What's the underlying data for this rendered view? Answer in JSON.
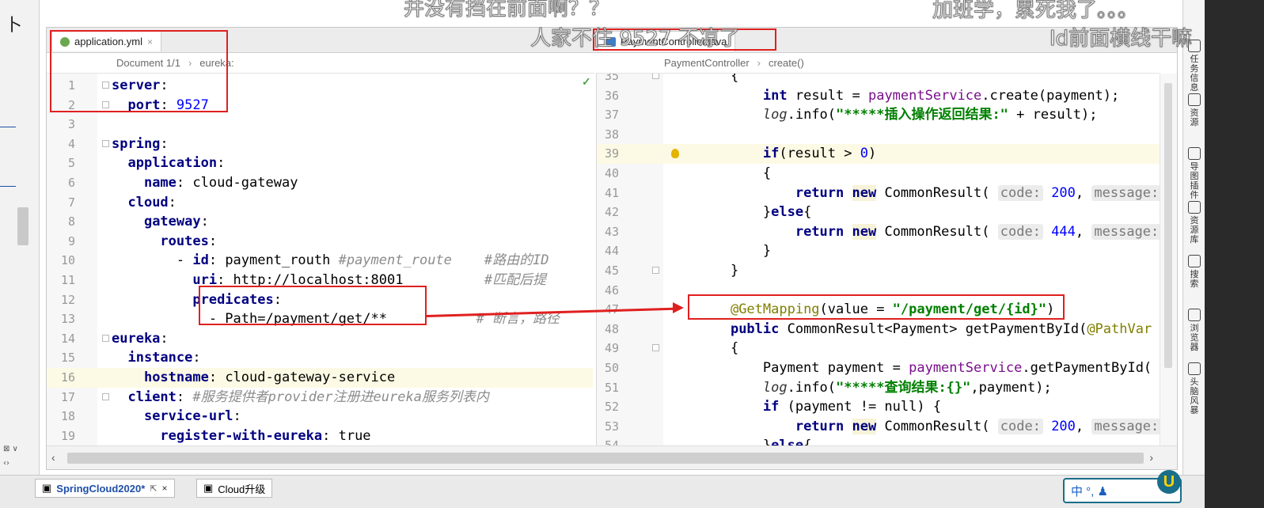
{
  "tabs": [
    {
      "label": "application.yml",
      "type": "yml"
    },
    {
      "label": "PaymentController.java",
      "type": "java"
    }
  ],
  "left_crumbs": [
    "Document 1/1",
    "eureka:"
  ],
  "right_crumbs": [
    "PaymentController",
    "create()"
  ],
  "yml_lines": [
    {
      "n": "1",
      "code": "server:"
    },
    {
      "n": "2",
      "code": "  port: 9527"
    },
    {
      "n": "3",
      "code": ""
    },
    {
      "n": "4",
      "code": "spring:"
    },
    {
      "n": "5",
      "code": "  application:"
    },
    {
      "n": "6",
      "code": "    name: cloud-gateway"
    },
    {
      "n": "7",
      "code": "  cloud:"
    },
    {
      "n": "8",
      "code": "    gateway:"
    },
    {
      "n": "9",
      "code": "      routes:"
    },
    {
      "n": "10",
      "code": "        - id: payment_routh #payment_route    #路由的ID"
    },
    {
      "n": "11",
      "code": "          uri: http://localhost:8001          #匹配后提"
    },
    {
      "n": "12",
      "code": "          predicates:"
    },
    {
      "n": "13",
      "code": "            - Path=/payment/get/**           # 断言，路径"
    },
    {
      "n": "14",
      "code": "eureka:"
    },
    {
      "n": "15",
      "code": "  instance:"
    },
    {
      "n": "16",
      "code": "    hostname: cloud-gateway-service"
    },
    {
      "n": "17",
      "code": "  client: #服务提供者provider注册进eureka服务列表内"
    },
    {
      "n": "18",
      "code": "    service-url:"
    },
    {
      "n": "19",
      "code": "      register-with-eureka: true"
    }
  ],
  "java_lines": [
    {
      "n": "35",
      "code": "    {"
    },
    {
      "n": "36",
      "code": "        int result = paymentService.create(payment);"
    },
    {
      "n": "37",
      "code": "        log.info(\"*****插入操作返回结果:\" + result);"
    },
    {
      "n": "38",
      "code": ""
    },
    {
      "n": "39",
      "code": "        if(result > 0)"
    },
    {
      "n": "40",
      "code": "        {"
    },
    {
      "n": "41",
      "code": "            return new CommonResult( code: 200, message: \""
    },
    {
      "n": "42",
      "code": "        }else{"
    },
    {
      "n": "43",
      "code": "            return new CommonResult( code: 444, message: \""
    },
    {
      "n": "44",
      "code": "        }"
    },
    {
      "n": "45",
      "code": "    }"
    },
    {
      "n": "46",
      "code": ""
    },
    {
      "n": "47",
      "code": "    @GetMapping(value = \"/payment/get/{id}\")"
    },
    {
      "n": "48",
      "code": "    public CommonResult<Payment> getPaymentById(@PathVar"
    },
    {
      "n": "49",
      "code": "    {"
    },
    {
      "n": "50",
      "code": "        Payment payment = paymentService.getPaymentById("
    },
    {
      "n": "51",
      "code": "        log.info(\"*****查询结果:{}\",payment);"
    },
    {
      "n": "52",
      "code": "        if (payment != null) {"
    },
    {
      "n": "53",
      "code": "            return new CommonResult( code: 200, message: \""
    },
    {
      "n": "54",
      "code": "        }else{"
    }
  ],
  "side_toolbar": [
    "任务信息",
    "资源",
    "导图插件",
    "资源库",
    "搜索",
    "浏览器",
    "头脑风暴"
  ],
  "taskbar_tabs": [
    "SpringCloud2020*",
    "Cloud升级"
  ],
  "ime_text": "中 °,",
  "subtitles": {
    "top_center": "并没有挡在前面啊？？",
    "mid_center": "人家不住 9527 不凉了",
    "top_right": "加班学，累死我了。。。",
    "mid_right": "Id前面横线干嘛"
  },
  "left_strip_glyph": "卜",
  "colors": {
    "annotation": "#e02020",
    "string": "#008000",
    "keyword": "#000080"
  }
}
